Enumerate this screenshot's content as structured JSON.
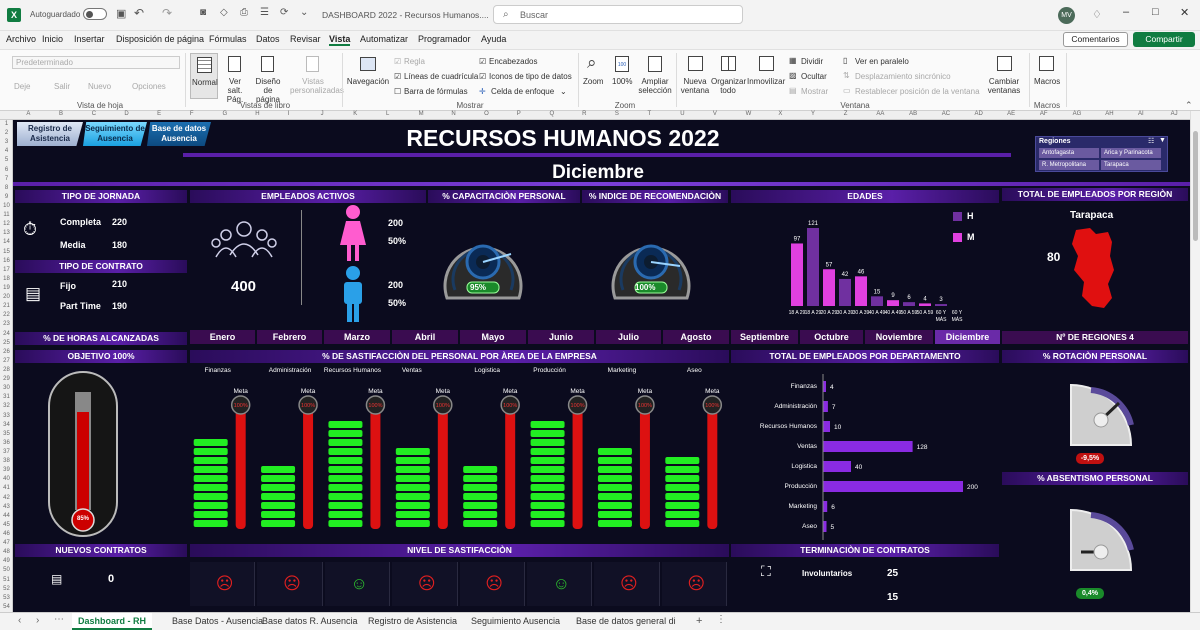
{
  "titlebar": {
    "autosave": "Autoguardado",
    "doc_title": "DASHBOARD 2022 - Recursos Humanos....",
    "search_placeholder": "Buscar",
    "user_initials": "MV"
  },
  "menu": [
    "Archivo",
    "Inicio",
    "Insertar",
    "Disposición de página",
    "Fórmulas",
    "Datos",
    "Revisar",
    "Vista",
    "Automatizar",
    "Programador",
    "Ayuda"
  ],
  "menu_active": "Vista",
  "comments_btn": "Comentarios",
  "share_btn": "Compartir",
  "ribbon": {
    "sheetview": {
      "dropdown": "Predeterminado",
      "dejar": "Deje",
      "salir": "Salir",
      "nuevo": "Nuevo",
      "opciones": "Opciones",
      "label": "Vista de hoja"
    },
    "bookviews": {
      "normal": "Normal",
      "saltos": "Ver salt. Pág.",
      "diseno": "Diseño de página",
      "vistas": "Vistas personalizadas",
      "label": "Vistas de libro"
    },
    "show": {
      "navegacion": "Navegación",
      "regla": "Regla",
      "lineas": "Líneas de cuadrícula",
      "barra": "Barra de fórmulas",
      "encabezados": "Encabezados",
      "iconos": "Iconos de tipo de datos",
      "celda": "Celda de enfoque",
      "label": "Mostrar"
    },
    "zoom": {
      "zoom": "Zoom",
      "pct": "100%",
      "ajustar": "Ampliar selección",
      "label": "Zoom"
    },
    "window": {
      "nueva": "Nueva ventana",
      "organizar": "Organizar todo",
      "inmovilizar": "Inmovilizar",
      "dividir": "Dividir",
      "ocultar": "Ocultar",
      "mostrar": "Mostrar",
      "paralelo": "Ver en paralelo",
      "sincronico": "Desplazamiento sincrónico",
      "restablecer": "Restablecer posición de la ventana",
      "cambiar": "Cambiar ventanas",
      "label": "Ventana"
    },
    "macros": {
      "macros": "Macros",
      "label": "Macros"
    }
  },
  "columns": [
    "A",
    "B",
    "C",
    "D",
    "E",
    "F",
    "G",
    "H",
    "I",
    "J",
    "K",
    "L",
    "M",
    "N",
    "O",
    "P",
    "Q",
    "R",
    "S",
    "T",
    "U",
    "V",
    "W",
    "X",
    "Y",
    "Z",
    "AA",
    "AB",
    "AC",
    "AD",
    "AE",
    "AF",
    "AG",
    "AH",
    "AI",
    "AJ"
  ],
  "rows": [
    "1",
    "2",
    "3",
    "4",
    "5",
    "6",
    "7",
    "8",
    "9",
    "10",
    "11",
    "12",
    "13",
    "14",
    "15",
    "16",
    "17",
    "18",
    "19",
    "20",
    "21",
    "22",
    "23",
    "24",
    "25",
    "26",
    "27",
    "28",
    "29",
    "30",
    "31",
    "32",
    "33",
    "34",
    "35",
    "36",
    "37",
    "38",
    "39",
    "40",
    "41",
    "42",
    "43",
    "44",
    "45",
    "46",
    "47",
    "48",
    "49",
    "50",
    "51",
    "52",
    "53",
    "54"
  ],
  "nav_buttons": [
    "Registro de Asistencia",
    "Seguimiento de Ausencia",
    "Base de datos Ausencia"
  ],
  "dashboard_title": "RECURSOS HUMANOS 2022",
  "month": "Diciembre",
  "slicer": {
    "title": "Regiones",
    "items": [
      "Antofagasta",
      "Arica y Parinacota",
      "R. Metropolitana",
      "Tarapaca"
    ]
  },
  "jornada": {
    "title": "TIPO DE JORNADA",
    "completa_label": "Completa",
    "completa": "220",
    "media_label": "Media",
    "media": "180"
  },
  "contrato": {
    "title": "TIPO DE CONTRATO",
    "fijo_label": "Fijo",
    "fijo": "210",
    "part_label": "Part Time",
    "part": "190"
  },
  "empleados": {
    "title": "EMPLEADOS ACTIVOS",
    "total": "400",
    "mujeres": "200",
    "mujeres_pct": "50%",
    "hombres": "200",
    "hombres_pct": "50%"
  },
  "capacitacion": {
    "title": "% CAPACITACIÒN PERSONAL",
    "value": "95%"
  },
  "recomendacion": {
    "title": "% INDICE DE RECOMENDACIÒN",
    "value": "100%"
  },
  "edades": {
    "title": "EDADES",
    "legend_h": "H",
    "legend_m": "M"
  },
  "region_total": {
    "title": "TOTAL DE EMPLEADOS POR REGIÒN",
    "region": "Tarapaca",
    "value": "80"
  },
  "horas": {
    "title": "% DE HORAS ALCANZADAS",
    "objetivo": "OBJETIVO  100%",
    "thermo_value": "85%"
  },
  "months": [
    "Enero",
    "Febrero",
    "Marzo",
    "Abril",
    "Mayo",
    "Junio",
    "Julio",
    "Agosto",
    "Septiembre",
    "Octubre",
    "Noviembre",
    "Diciembre"
  ],
  "satisfaccion_area": {
    "title": "%  DE SASTIFACCIÒN DEL PERSONAL POR ÀREA DE LA EMPRESA",
    "meta_label": "Meta",
    "meta_value": "100%"
  },
  "departamentos": {
    "title": "TOTAL DE EMPLEADOS POR DEPARTAMENTO"
  },
  "regiones_count": {
    "title": "Nº DE REGIONES 4"
  },
  "rotacion": {
    "title": "% ROTACIÒN PERSONAL",
    "value": "-9,5%"
  },
  "absentismo": {
    "title": "% ABSENTISMO PERSONAL",
    "value": "0,4%"
  },
  "nuevos": {
    "title": "NUEVOS CONTRATOS",
    "value": "0"
  },
  "nivel": {
    "title": "NIVEL DE SASTIFACCIÒN",
    "faces": [
      "sad",
      "sad",
      "happy",
      "sad",
      "sad",
      "happy",
      "sad",
      "sad"
    ]
  },
  "terminacion": {
    "title": "TERMINACIÒN DE CONTRATOS",
    "involuntarios_label": "Involuntarios",
    "involuntarios": "25",
    "otros": "15"
  },
  "tabs": [
    "Dashboard - RH",
    "Base Datos - Ausencia",
    "Base datos R. Ausencia",
    "Registro de Asistencia",
    "Seguimiento Ausencia",
    "Base de datos general di"
  ],
  "colors": {
    "accent": "#107c41",
    "panel_header": "#5a1fa8",
    "bg": "#0b0b1e",
    "bar_h": "#7030a0",
    "bar_m": "#e040e0",
    "green": "#22ee22",
    "red": "#dd1111"
  },
  "chart_data": [
    {
      "type": "bar",
      "title": "EDADES",
      "categories": [
        "18 A 29",
        "18 A 29",
        "20 A 29",
        "30 A 39",
        "30 A 39",
        "40 A 49",
        "40 A 49",
        "50 A 59",
        "50 A 59",
        "60 Y MÁS",
        "60 Y MÁS"
      ],
      "series": [
        {
          "name": "H",
          "values": [
            null,
            121,
            null,
            42,
            null,
            15,
            null,
            6,
            null,
            3,
            null
          ]
        },
        {
          "name": "M",
          "values": [
            97,
            null,
            57,
            null,
            46,
            null,
            9,
            null,
            4,
            null,
            null
          ]
        }
      ],
      "labels": [
        "97",
        "121",
        "57",
        "42",
        "46",
        "15",
        "9",
        "6",
        "4",
        "3"
      ]
    },
    {
      "type": "bar",
      "title": "TOTAL DE EMPLEADOS POR DEPARTAMENTO",
      "categories": [
        "Finanzas",
        "Administración",
        "Recursos Humanos",
        "Ventas",
        "Logistica",
        "Producción",
        "Marketing",
        "Aseo"
      ],
      "values": [
        4,
        7,
        10,
        128,
        40,
        200,
        6,
        5
      ]
    },
    {
      "type": "bar",
      "title": "%  DE SASTIFACCIÒN DEL PERSONAL POR ÀREA DE LA EMPRESA",
      "categories": [
        "Finanzas",
        "Administración",
        "Recursos Humanos",
        "Ventas",
        "Logistica",
        "Producción",
        "Marketing",
        "Aseo"
      ],
      "values": [
        10,
        7,
        12,
        9,
        7,
        12,
        9,
        8
      ],
      "meta": 100
    }
  ]
}
